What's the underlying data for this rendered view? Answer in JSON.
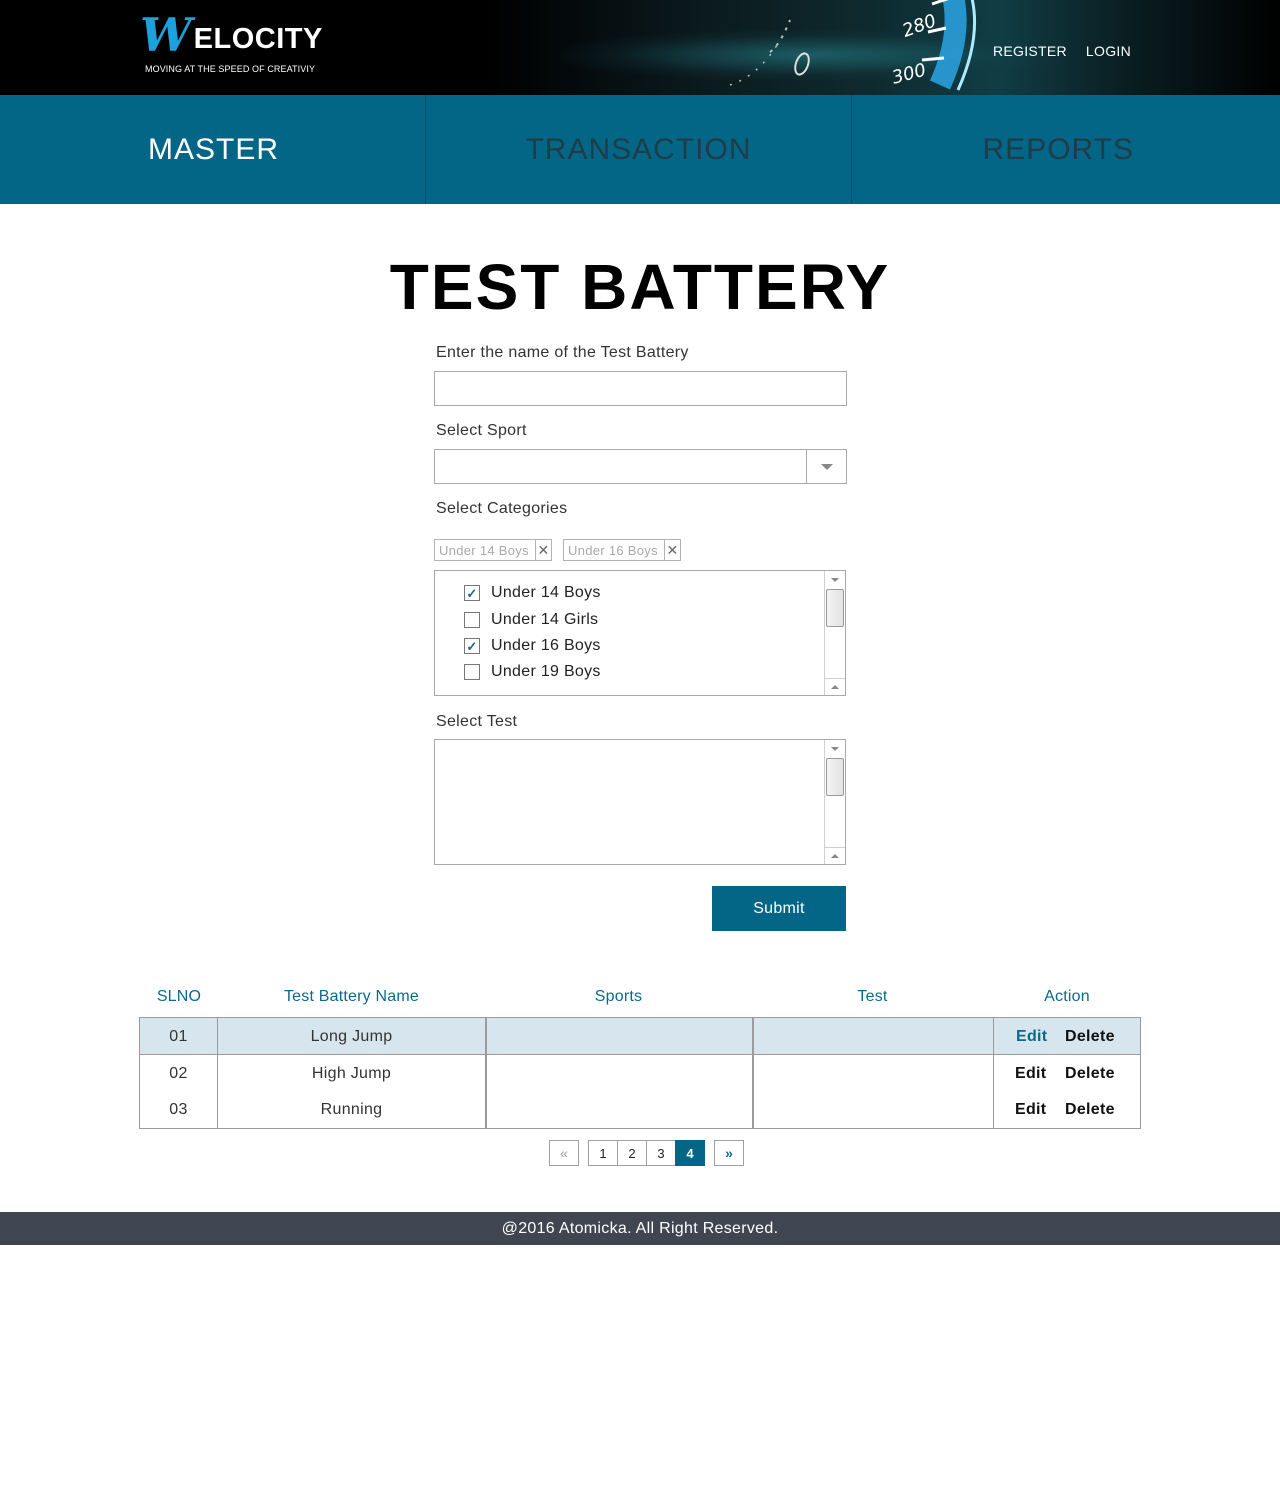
{
  "brand": {
    "logo_letter": "W",
    "logo_text": "ELOCITY",
    "tagline": "MOVING AT THE SPEED OF CREATIVIY",
    "gauge_label_1": "280",
    "gauge_label_2": "300"
  },
  "header": {
    "register_label": "REGISTER",
    "login_label": "LOGIN"
  },
  "nav": {
    "items": [
      {
        "label": "MASTER",
        "active": true
      },
      {
        "label": "TRANSACTION",
        "active": false
      },
      {
        "label": "REPORTS",
        "active": false
      }
    ]
  },
  "form": {
    "title": "TEST BATTERY",
    "name_label": "Enter the name of the Test Battery",
    "name_value": "",
    "sport_label": "Select Sport",
    "sport_value": "",
    "categories_label": "Select Categories",
    "selected_chips": [
      "Under 14 Boys",
      "Under 16 Boys"
    ],
    "chip_remove_glyph": "✕",
    "category_options": [
      {
        "label": "Under 14 Boys",
        "checked": true
      },
      {
        "label": "Under 14 Girls",
        "checked": false
      },
      {
        "label": "Under 16 Boys",
        "checked": true
      },
      {
        "label": "Under 19 Boys",
        "checked": false
      }
    ],
    "test_label": "Select Test",
    "submit_label": "Submit"
  },
  "table": {
    "headers": [
      "SLNO",
      "Test Battery Name",
      "Sports",
      "Test",
      "Action"
    ],
    "rows": [
      {
        "slno": "01",
        "name": "Long Jump",
        "sports": "",
        "test": "",
        "edit": "Edit",
        "delete": "Delete"
      },
      {
        "slno": "02",
        "name": "High Jump",
        "sports": "",
        "test": "",
        "edit": "Edit",
        "delete": "Delete"
      },
      {
        "slno": "03",
        "name": "Running",
        "sports": "",
        "test": "",
        "edit": "Edit",
        "delete": "Delete"
      }
    ]
  },
  "pagination": {
    "prev_glyph": "«",
    "next_glyph": "»",
    "pages": [
      "1",
      "2",
      "3",
      "4"
    ],
    "current_page": "4"
  },
  "footer": {
    "text": "@2016 Atomicka. All Right Reserved."
  },
  "colors": {
    "primary": "#046687",
    "accent_blue": "#1ba2dc",
    "row_highlight": "#d7e6ee",
    "footer_bg": "#404651"
  }
}
